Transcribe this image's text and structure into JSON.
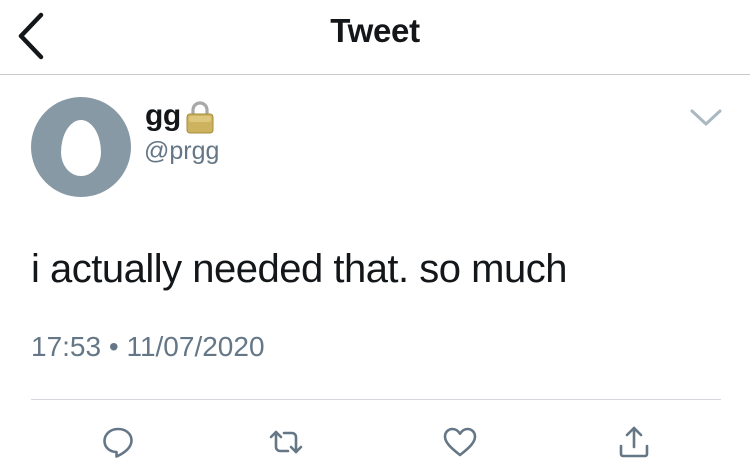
{
  "header": {
    "title": "Tweet",
    "back_icon": "chevron-left-icon"
  },
  "tweet": {
    "author": {
      "display_name": "gg",
      "handle": "@prgg",
      "protected_icon": "lock-icon",
      "avatar": "default-egg-avatar"
    },
    "menu_icon": "chevron-down-icon",
    "text": "i actually needed that. so much",
    "time": "17:53",
    "separator": "•",
    "date": "11/07/2020"
  },
  "actions": [
    {
      "name": "reply",
      "icon": "reply-icon"
    },
    {
      "name": "retweet",
      "icon": "retweet-icon"
    },
    {
      "name": "like",
      "icon": "heart-icon"
    },
    {
      "name": "share",
      "icon": "share-icon"
    }
  ],
  "colors": {
    "text": "#14171a",
    "secondary": "#657786",
    "avatar_bg": "#8899a6",
    "divider": "#d5d9dd"
  }
}
